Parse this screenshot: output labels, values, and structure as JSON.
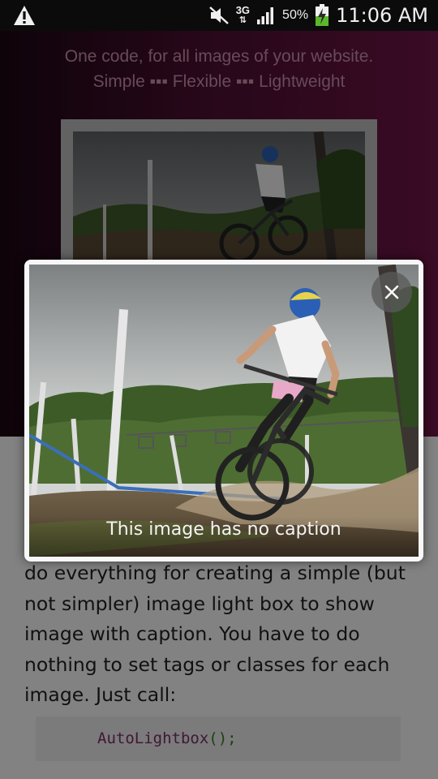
{
  "status_bar": {
    "network": "3G",
    "battery": "50%",
    "time": "11:06 AM",
    "icons": [
      "warning-icon",
      "mute-icon",
      "network-3g-icon",
      "signal-icon",
      "battery-charging-icon"
    ]
  },
  "hero": {
    "tagline_line1": "One code, for all images of your website.",
    "tagline_line2": "Simple ▪▪▪ Flexible ▪▪▪ Lightweight",
    "thumbnail_icon": "mountain-bike-photo"
  },
  "content": {
    "paragraph": "do everything for creating a simple (but not simpler) image light box to show image with caption. You have to do nothing to set tags or classes for each image. Just call:",
    "code_name": "AutoLightbox",
    "code_punct": "();"
  },
  "lightbox": {
    "caption": "This image has no caption",
    "close_icon": "close-icon",
    "image_icon": "mountain-bike-photo"
  },
  "colors": {
    "hero_gradient_start": "#1c0713",
    "hero_gradient_end": "#6f1646",
    "tagline": "#c78fab",
    "overlay": "rgba(0,0,0,0.48)"
  }
}
